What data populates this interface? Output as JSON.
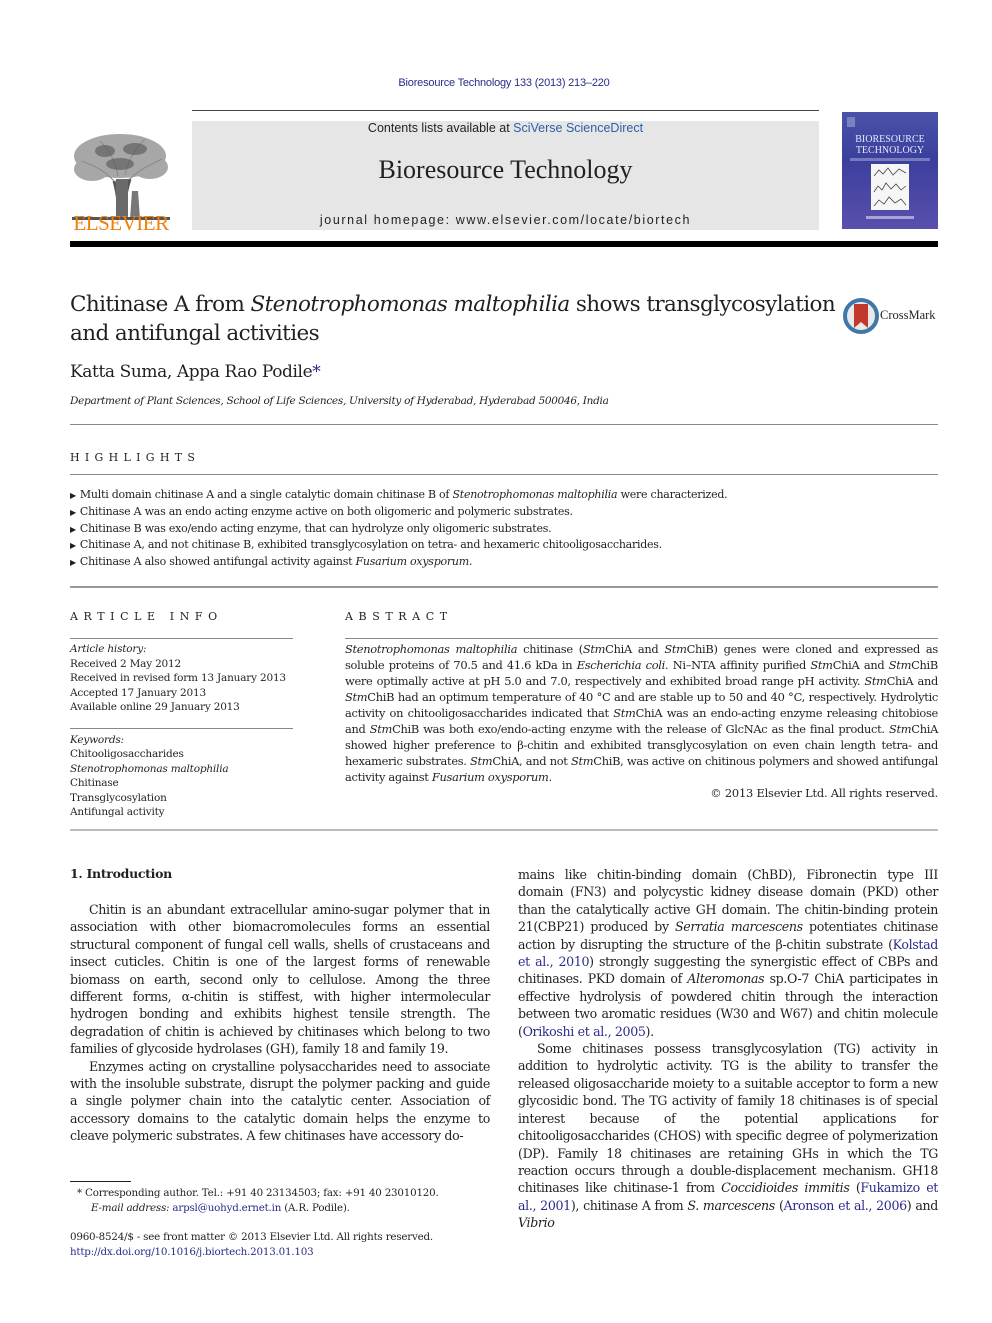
{
  "header": {
    "citation": "Bioresource Technology 133 (2013) 213–220",
    "contents_prefix": "Contents lists available at ",
    "contents_link": "SciVerse ScienceDirect",
    "journal_name": "Bioresource Technology",
    "homepage": "journal homepage: www.elsevier.com/locate/biortech",
    "publisher_logo_text": "ELSEVIER",
    "cover_title_line1": "BIORESOURCE",
    "cover_title_line2": "TECHNOLOGY",
    "crossmark_label": "CrossMark",
    "colors": {
      "link": "#2b2b8c",
      "elsevier_orange": "#f07f0a",
      "banner_bg": "#e6e6e6",
      "cover_blue": "#4b52a8"
    }
  },
  "article": {
    "title_part1": "Chitinase A from ",
    "title_italic": "Stenotrophomonas maltophilia",
    "title_part2": " shows transglycosylation and antifungal activities",
    "authors": "Katta Suma, Appa Rao Podile",
    "author_mark": "*",
    "affiliation": "Department of Plant Sciences, School of Life Sciences, University of Hyderabad, Hyderabad 500046, India"
  },
  "highlights": {
    "heading": "HIGHLIGHTS",
    "items": [
      {
        "pre": "Multi domain chitinase A and a single catalytic domain chitinase B of ",
        "italic": "Stenotrophomonas maltophilia",
        "post": " were characterized."
      },
      {
        "pre": "Chitinase A was an endo acting enzyme active on both oligomeric and polymeric substrates.",
        "italic": "",
        "post": ""
      },
      {
        "pre": "Chitinase B was exo/endo acting enzyme, that can hydrolyze only oligomeric substrates.",
        "italic": "",
        "post": ""
      },
      {
        "pre": "Chitinase A, and not chitinase B, exhibited transglycosylation on tetra- and hexameric chitooligosaccharides.",
        "italic": "",
        "post": ""
      },
      {
        "pre": "Chitinase A also showed antifungal activity against ",
        "italic": "Fusarium oxysporum",
        "post": "."
      }
    ]
  },
  "article_info": {
    "heading": "ARTICLE INFO",
    "history_label": "Article history:",
    "history": [
      "Received 2 May 2012",
      "Received in revised form 13 January 2013",
      "Accepted 17 January 2013",
      "Available online 29 January 2013"
    ],
    "keywords_label": "Keywords:",
    "keywords": [
      "Chitooligosaccharides",
      "Stenotrophomonas maltophilia",
      "Chitinase",
      "Transglycosylation",
      "Antifungal activity"
    ]
  },
  "abstract": {
    "heading": "ABSTRACT",
    "segments": [
      [
        "i",
        "Stenotrophomonas maltophilia"
      ],
      [
        "n",
        " chitinase ("
      ],
      [
        "i",
        "Stm"
      ],
      [
        "n",
        "ChiA and "
      ],
      [
        "i",
        "Stm"
      ],
      [
        "n",
        "ChiB) genes were cloned and expressed as soluble proteins of 70.5 and 41.6 kDa in "
      ],
      [
        "i",
        "Escherichia coli"
      ],
      [
        "n",
        ". Ni–NTA affinity purified "
      ],
      [
        "i",
        "Stm"
      ],
      [
        "n",
        "ChiA and "
      ],
      [
        "i",
        "Stm"
      ],
      [
        "n",
        "ChiB were optimally active at pH 5.0 and 7.0, respectively and exhibited broad range pH activity. "
      ],
      [
        "i",
        "Stm"
      ],
      [
        "n",
        "ChiA and "
      ],
      [
        "i",
        "Stm"
      ],
      [
        "n",
        "ChiB had an optimum temperature of 40 °C and are stable up to 50 and 40 °C, respectively. Hydrolytic activity on chitooligosaccharides indicated that "
      ],
      [
        "i",
        "Stm"
      ],
      [
        "n",
        "ChiA was an endo-acting enzyme releasing chitobiose and "
      ],
      [
        "i",
        "Stm"
      ],
      [
        "n",
        "ChiB was both exo/endo-acting enzyme with the release of GlcNAc as the final product. "
      ],
      [
        "i",
        "Stm"
      ],
      [
        "n",
        "ChiA showed higher preference to β-chitin and exhibited transglycosylation on even chain length tetra- and hexameric substrates. "
      ],
      [
        "i",
        "Stm"
      ],
      [
        "n",
        "ChiA, and not "
      ],
      [
        "i",
        "Stm"
      ],
      [
        "n",
        "ChiB, was active on chitinous polymers and showed antifungal activity against "
      ],
      [
        "i",
        "Fusarium oxysporum"
      ],
      [
        "n",
        "."
      ]
    ],
    "copyright": "© 2013 Elsevier Ltd. All rights reserved."
  },
  "body": {
    "section_heading": "1. Introduction",
    "left_paragraphs": [
      {
        "indent": true,
        "segments": [
          [
            "n",
            "Chitin is an abundant extracellular amino-sugar polymer that in association with other biomacromolecules forms an essential structural component of fungal cell walls, shells of crustaceans and insect cuticles. Chitin is one of the largest forms of renewable biomass on earth, second only to cellulose. Among the three different forms, α-chitin is stiffest, with higher intermolecular hydrogen bonding and exhibits highest tensile strength. The degradation of chitin is achieved by chitinases which belong to two families of glycoside hydrolases (GH), family 18 and family 19."
          ]
        ]
      },
      {
        "indent": true,
        "segments": [
          [
            "n",
            "Enzymes acting on crystalline polysaccharides need to associate with the insoluble substrate, disrupt the polymer packing and guide a single polymer chain into the catalytic center. Association of accessory domains to the catalytic domain helps the enzyme to cleave polymeric substrates. A few chitinases have accessory do-"
          ]
        ]
      }
    ],
    "right_paragraphs": [
      {
        "indent": false,
        "segments": [
          [
            "n",
            "mains like chitin-binding domain (ChBD), Fibronectin type III domain (FN3) and polycystic kidney disease domain (PKD) other than the catalytically active GH domain. The chitin-binding protein 21(CBP21) produced by "
          ],
          [
            "i",
            "Serratia marcescens"
          ],
          [
            "n",
            " potentiates chitinase action by disrupting the structure of the β-chitin substrate ("
          ],
          [
            "l",
            "Kolstad et al., 2010"
          ],
          [
            "n",
            ") strongly suggesting the synergistic effect of CBPs and chitinases. PKD domain of "
          ],
          [
            "i",
            "Alteromonas"
          ],
          [
            "n",
            " sp.O-7 ChiA participates in effective hydrolysis of powdered chitin through the interaction between two aromatic residues (W30 and W67) and chitin molecule ("
          ],
          [
            "l",
            "Orikoshi et al., 2005"
          ],
          [
            "n",
            ")."
          ]
        ]
      },
      {
        "indent": true,
        "segments": [
          [
            "n",
            "Some chitinases possess transglycosylation (TG) activity in addition to hydrolytic activity. TG is the ability to transfer the released oligosaccharide moiety to a suitable acceptor to form a new glycosidic bond. The TG activity of family 18 chitinases is of special interest because of the potential applications for chitooligosaccharides (CHOS) with specific degree of polymerization (DP). Family 18 chitinases are retaining GHs in which the TG reaction occurs through a double-displacement mechanism. GH18 chitinases like chitinase-1 from "
          ],
          [
            "i",
            "Coccidioides immitis"
          ],
          [
            "n",
            " ("
          ],
          [
            "l",
            "Fukamizo et al., 2001"
          ],
          [
            "n",
            "), chitinase A from "
          ],
          [
            "i",
            "S. marcescens"
          ],
          [
            "n",
            " ("
          ],
          [
            "l",
            "Aronson et al., 2006"
          ],
          [
            "n",
            ") and "
          ],
          [
            "i",
            "Vibrio"
          ]
        ]
      }
    ]
  },
  "footnote": {
    "mark": "*",
    "corresponding": "Corresponding author. Tel.: +91 40 23134503; fax: +91 40 23010120.",
    "email_label": "E-mail address:",
    "email": "arpsl@uohyd.ernet.in",
    "email_suffix": " (A.R. Podile).",
    "front_matter": "0960-8524/$ - see front matter © 2013 Elsevier Ltd. All rights reserved.",
    "doi": "http://dx.doi.org/10.1016/j.biortech.2013.01.103"
  }
}
